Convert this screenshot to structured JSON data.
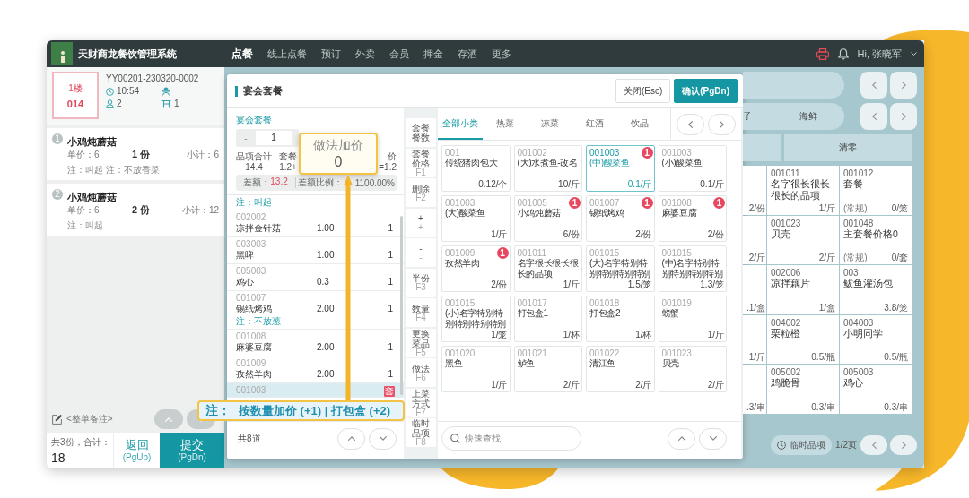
{
  "top_bar": {
    "app_title": "天财商龙餐饮管理系统",
    "nav": [
      {
        "label": "点餐",
        "selected": true
      },
      {
        "label": "线上点餐",
        "selected": false
      },
      {
        "label": "预订",
        "selected": false
      },
      {
        "label": "外卖",
        "selected": false
      },
      {
        "label": "会员",
        "selected": false
      },
      {
        "label": "押金",
        "selected": false
      },
      {
        "label": "存酒",
        "selected": false
      },
      {
        "label": "更多",
        "selected": false
      }
    ],
    "user": "Hi, 张晓军"
  },
  "order_panel": {
    "table_area": "1楼",
    "table_number": "014",
    "order_number": "YY00201-230320-0002",
    "time": "10:54",
    "guests": "2",
    "tables": "1",
    "items": [
      {
        "index": "1",
        "name": "小鸡炖蘑菇",
        "unit_price": "单价：6",
        "quantity": "1 份",
        "subtotal": "小计：6",
        "note": "注：叫起 注：不放香菜"
      },
      {
        "index": "2",
        "name": "小鸡炖蘑菇",
        "unit_price": "单价：6",
        "quantity": "2 份",
        "subtotal": "小计：12",
        "note": "注：叫起"
      }
    ],
    "remark": "<整单备注>",
    "summary": "共3份，合计：",
    "total": "18",
    "buttons": [
      {
        "label": "返回",
        "shortcut": "(PgUp)",
        "kind": "secondary"
      },
      {
        "label": "提交",
        "shortcut": "(PgDn)",
        "kind": "primary"
      }
    ]
  },
  "dialog": {
    "title": "宴会套餐",
    "buttons": [
      {
        "label": "关闭(Esc)",
        "kind": "secondary"
      },
      {
        "label": "确认(PgDn)",
        "kind": "primary"
      }
    ],
    "package": {
      "name": "宴会套餐",
      "minus": "-",
      "count": "1",
      "totals": [
        {
          "label": "品项合计",
          "value": "14.4"
        },
        {
          "label": "套餐",
          "value": "1.2+"
        },
        {
          "label": "价",
          "value": "=1.2"
        }
      ],
      "difference_label": "差额：",
      "difference": "13.2",
      "ratio_label": "差额比例：",
      "ratio": "1100.00%",
      "note": "注：叫起"
    },
    "rows": [
      {
        "code": "002002",
        "name": "凉拌金针菇",
        "price": "1.00",
        "qty": "1",
        "selected": false
      },
      {
        "code": "003003",
        "name": "黑啤",
        "price": "1.00",
        "qty": "1",
        "selected": false
      },
      {
        "code": "005003",
        "name": "鸡心",
        "price": "0.3",
        "qty": "1",
        "selected": false
      },
      {
        "code": "001007",
        "name": "锡纸烤鸡",
        "price": "2.00",
        "qty": "1",
        "note": "注：不放葱",
        "selected": false
      },
      {
        "code": "001008",
        "name": "麻婆豆腐",
        "price": "2.00",
        "qty": "1",
        "selected": false
      },
      {
        "code": "001009",
        "name": "孜然羊肉",
        "price": "2.00",
        "qty": "1",
        "selected": false
      },
      {
        "code": "001003",
        "tag": "套",
        "selected": true
      }
    ],
    "row_count": "共8道",
    "actions": [
      {
        "label": "套餐餐数"
      },
      {
        "label": "套餐价格",
        "key": "F1"
      },
      {
        "label": "删除",
        "key": "F2"
      },
      {
        "label": "+",
        "key": "+"
      },
      {
        "label": "-",
        "key": "-"
      },
      {
        "label": "半份",
        "key": "F3"
      },
      {
        "label": "数量",
        "key": "F4"
      },
      {
        "label": "更换菜品",
        "key": "F5"
      },
      {
        "label": "做法",
        "key": "F6"
      },
      {
        "label": "上菜方式",
        "key": "F7"
      },
      {
        "label": "临时品项",
        "key": "F8"
      }
    ],
    "tabs": [
      {
        "label": "全部小类",
        "selected": true
      },
      {
        "label": "热菜",
        "selected": false
      },
      {
        "label": "凉菜",
        "selected": false
      },
      {
        "label": "红酒",
        "selected": false
      },
      {
        "label": "饮品",
        "selected": false
      }
    ],
    "items": [
      {
        "code": "001",
        "name": "传统猪肉包大",
        "price": "0.12/个",
        "selected": false
      },
      {
        "code": "001002",
        "name": "(大)水煮鱼-改名",
        "price": "10/斤",
        "selected": false
      },
      {
        "code": "001003",
        "name": "(中)酸菜鱼",
        "price": "0.1/斤",
        "selected": true,
        "count": "1"
      },
      {
        "code": "001003",
        "name": "(小)酸菜鱼",
        "price": "0.1/斤",
        "selected": false
      },
      {
        "code": "001003",
        "name": "(大)酸菜鱼",
        "price": "1/斤",
        "selected": false
      },
      {
        "code": "001005",
        "name": "小鸡炖蘑菇",
        "price": "6/份",
        "selected": false,
        "count": "1"
      },
      {
        "code": "001007",
        "name": "锡纸烤鸡",
        "price": "2/份",
        "selected": false,
        "count": "1"
      },
      {
        "code": "001008",
        "name": "麻婆豆腐",
        "price": "2/份",
        "selected": false,
        "count": "1"
      },
      {
        "code": "001009",
        "name": "孜然羊肉",
        "price": "2/份",
        "selected": false,
        "count": "1"
      },
      {
        "code": "001011",
        "name": "名字很长很长很长的品项",
        "price": "1/斤",
        "selected": false
      },
      {
        "code": "001015",
        "name": "(大)名字特别特别特别特别特别",
        "price": "1.5/笼",
        "selected": false
      },
      {
        "code": "001015",
        "name": "(中)名字特别特别特别特别特别",
        "price": "1.3/笼",
        "selected": false
      },
      {
        "code": "001015",
        "name": "(小)名字特别特别特别特别特别",
        "price": "1/笼",
        "selected": false
      },
      {
        "code": "001017",
        "name": "打包盒1",
        "price": "1/杯",
        "selected": false
      },
      {
        "code": "001018",
        "name": "打包盒2",
        "price": "1/杯",
        "selected": false
      },
      {
        "code": "001019",
        "name": "螃蟹",
        "price": "1/斤",
        "selected": false
      },
      {
        "code": "001020",
        "name": "黑鱼",
        "price": "1/斤",
        "selected": false
      },
      {
        "code": "001021",
        "name": "鲈鱼",
        "price": "2/斤",
        "selected": false
      },
      {
        "code": "001022",
        "name": "清江鱼",
        "price": "2/斤",
        "selected": false
      },
      {
        "code": "001023",
        "name": "贝壳",
        "price": "2/斤",
        "selected": false
      }
    ],
    "search": {
      "placeholder": "快速查找"
    }
  },
  "background": {
    "categories": [
      "子",
      "海鲜"
    ],
    "clear_button": "清零",
    "partial_prices": [
      "2/份",
      "2/斤",
      ".1/盒",
      "1/斤",
      ".3/串"
    ],
    "cards": [
      {
        "code": "001011",
        "name": "名字很长很长很长的品项",
        "price": "1/斤"
      },
      {
        "code": "001012",
        "name": "套餐",
        "tag": "(常规)",
        "price": "0/笼"
      },
      {
        "code": "001023",
        "name": "贝壳",
        "price": "2/斤"
      },
      {
        "code": "001048",
        "name": "主套餐价格0",
        "tag": "(常规)",
        "price": "0/套"
      },
      {
        "code": "002006",
        "name": "凉拌藕片",
        "price": "1/盒"
      },
      {
        "code": "003",
        "name": "鲅鱼灌汤包",
        "price": "3.8/笼"
      },
      {
        "code": "004002",
        "name": "栗粒橙",
        "price": "0.5/瓶"
      },
      {
        "code": "004003",
        "name": "小明同学",
        "price": "0.5/瓶"
      },
      {
        "code": "005002",
        "name": "鸡脆骨",
        "price": "0.3/串"
      },
      {
        "code": "005003",
        "name": "鸡心",
        "price": "0.3/串"
      }
    ],
    "temp_button": "临时品项",
    "page": "1/2页"
  },
  "annotations": {
    "popup": {
      "title": "做法加价",
      "value": "0"
    },
    "note": {
      "label": "注：",
      "text": "按数量加价 (+1) | 打包盒 (+2)"
    }
  }
}
